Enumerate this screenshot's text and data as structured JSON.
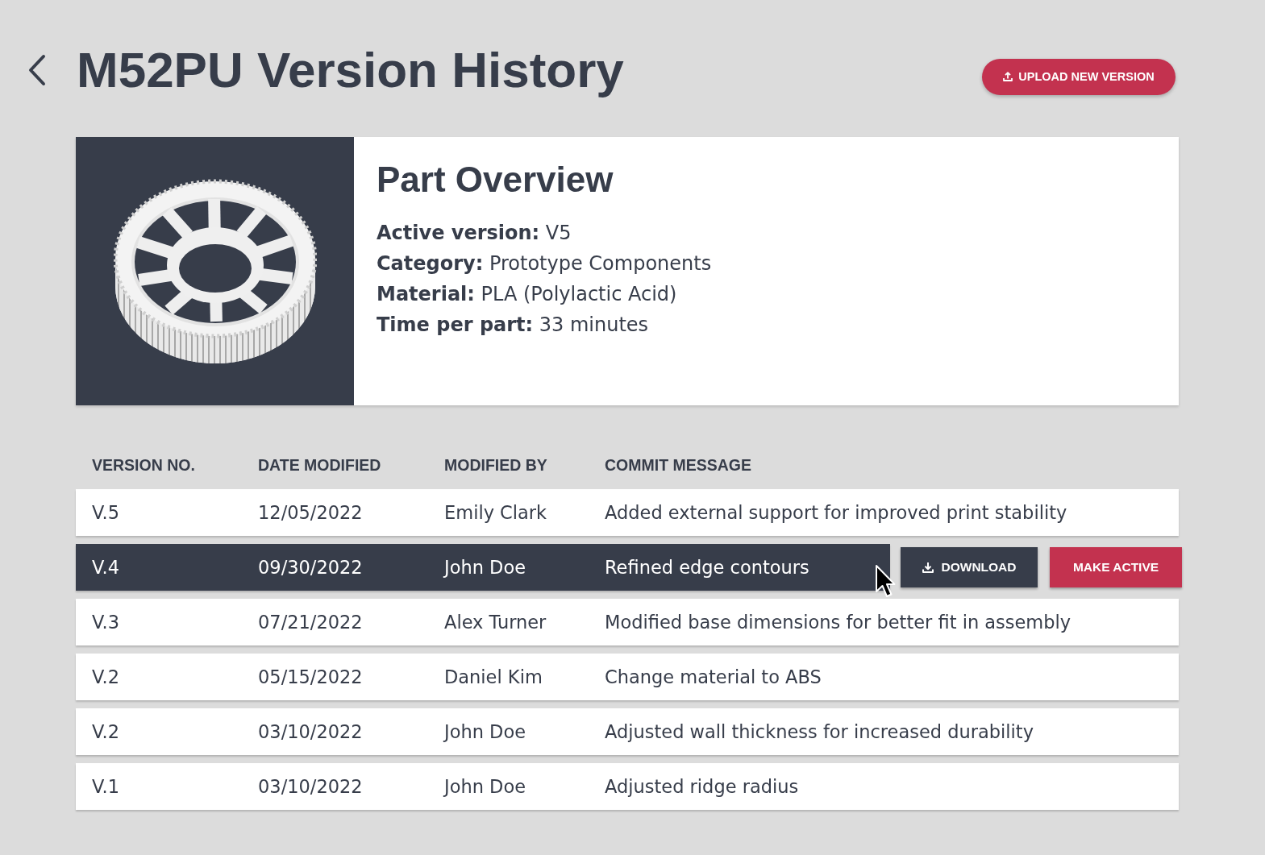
{
  "page": {
    "title": "M52PU Version History"
  },
  "upload_button": {
    "label": "UPLOAD NEW VERSION"
  },
  "part_overview": {
    "title": "Part Overview",
    "details": [
      "**Active version:** V5",
      "**Category:** Prototype Components",
      "**Material:** PLA (Polylactic Acid)",
      "**Time per part:** 33 minutes"
    ]
  },
  "table": {
    "columns": [
      "VERSION NO.",
      "DATE MODIFIED",
      "MODIFIED BY",
      "COMMIT MESSAGE"
    ],
    "rows": [
      {
        "version": "V.5",
        "date_modified": "12/05/2022",
        "modified_by": "Emily Clark",
        "commit_message": "Added external support for improved print stability",
        "selected": false
      },
      {
        "version": "V.4",
        "date_modified": "09/30/2022",
        "modified_by": "John Doe",
        "commit_message": "Refined edge contours",
        "selected": true
      },
      {
        "version": "V.3",
        "date_modified": "07/21/2022",
        "modified_by": "Alex Turner",
        "commit_message": "Modified base dimensions for better fit in assembly",
        "selected": false
      },
      {
        "version": "V.2",
        "date_modified": "05/15/2022",
        "modified_by": "Daniel Kim",
        "commit_message": "Change material to ABS",
        "selected": false
      },
      {
        "version": "V.2",
        "date_modified": "03/10/2022",
        "modified_by": "John Doe",
        "commit_message": "Adjusted wall thickness for increased durability",
        "selected": false
      },
      {
        "version": "V.1",
        "date_modified": "03/10/2022",
        "modified_by": "John Doe",
        "commit_message": "Adjusted ridge radius",
        "selected": false
      }
    ],
    "row_actions": [
      {
        "kind": "download",
        "label": "DOWNLOAD"
      },
      {
        "kind": "activate",
        "label": "MAKE ACTIVE"
      }
    ]
  }
}
